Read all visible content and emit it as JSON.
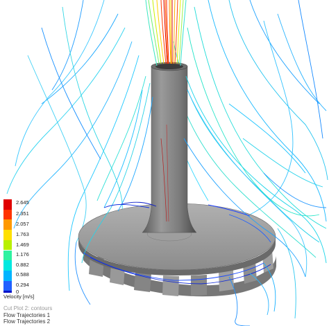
{
  "viewer": {
    "background": "#ffffff",
    "model_color": "#8a8a8a"
  },
  "colorbar": {
    "title": "Velocity [m/s]",
    "labels": [
      "2.645",
      "2.351",
      "2.057",
      "1.763",
      "1.469",
      "1.176",
      "0.882",
      "0.588",
      "0.294",
      "0"
    ],
    "colors": [
      "#e00000",
      "#ff3300",
      "#ff9900",
      "#ffe000",
      "#b8f000",
      "#2ef2a0",
      "#00e8e0",
      "#00b4ff",
      "#2060ff",
      "#0a14c8"
    ]
  },
  "legend": {
    "items": [
      "Cut Plot 2: contours",
      "Flow Trajectories 1",
      "Flow Trajectories 2"
    ]
  }
}
